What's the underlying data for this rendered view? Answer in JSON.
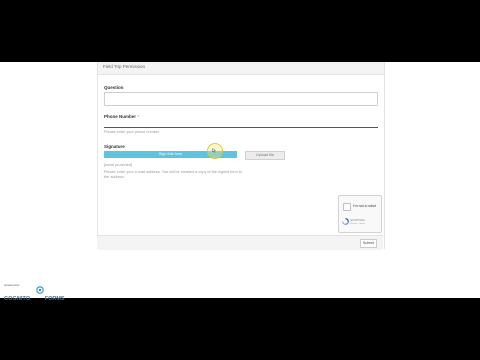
{
  "form": {
    "title": "Field Trip Permission",
    "question": {
      "label": "Question",
      "value": ""
    },
    "phone": {
      "label": "Phone Number",
      "required_mark": "*",
      "hint": "Please enter your phone number",
      "value": ""
    },
    "signature": {
      "label": "Signature",
      "sign_button": "Sign this form",
      "other_button": "Upload file",
      "email": "[email protected]",
      "hint_line1": "Please enter your e-mail address. You will be emailed a copy of the signed form to",
      "hint_line2": "the address."
    },
    "captcha": {
      "label": "I'm not a robot",
      "brand": "reCAPTCHA",
      "terms": "Privacy - Terms"
    },
    "submit_label": "Submit"
  },
  "branding": {
    "top": "powered by",
    "name": "COGNITO",
    "suffix": "FORMS"
  },
  "colors": {
    "accent": "#5fc3de",
    "required": "#d9534f",
    "brand": "#4a6d86",
    "letterbox": "#000000"
  }
}
